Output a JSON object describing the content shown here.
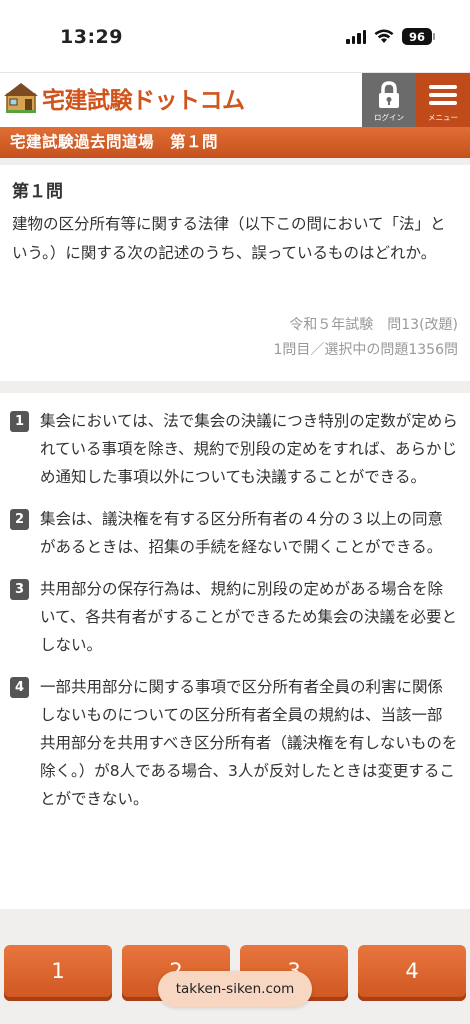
{
  "status": {
    "time": "13:29",
    "battery": "96",
    "icons": [
      "signal-icon",
      "wifi-icon",
      "battery-icon"
    ]
  },
  "header": {
    "logo_text": "宅建試験ドットコム",
    "login_label": "ログイン",
    "menu_label": "メニュー"
  },
  "subheader": {
    "title": "宅建試験過去問道場　第１問"
  },
  "question": {
    "title": "第１問",
    "text": "建物の区分所有等に関する法律（以下この問において「法」という。）に関する次の記述のうち、誤っているものはどれか。",
    "source": "令和５年試験　問13(改題)",
    "progress": "1問目／選択中の問題1356問"
  },
  "choices": [
    {
      "num": "1",
      "text": "集会においては、法で集会の決議につき特別の定数が定められている事項を除き、規約で別段の定めをすれば、あらかじめ通知した事項以外についても決議することができる。"
    },
    {
      "num": "2",
      "text": "集会は、議決権を有する区分所有者の４分の３以上の同意があるときは、招集の手続を経ないで開くことができる。"
    },
    {
      "num": "3",
      "text": "共用部分の保存行為は、規約に別段の定めがある場合を除いて、各共有者がすることができるため集会の決議を必要としない。"
    },
    {
      "num": "4",
      "text": "一部共用部分に関する事項で区分所有者全員の利害に関係しないものについての区分所有者全員の規約は、当該一部共用部分を共用すべき区分所有者（議決権を有しないものを除く。）が8人である場合、3人が反対したときは変更することができない。"
    }
  ],
  "answers": [
    "1",
    "2",
    "3",
    "4"
  ],
  "browser": {
    "url": "takken-siken.com"
  },
  "colors": {
    "accent": "#d0541c",
    "subheader": "#c6511d",
    "login_bg": "#6b6b6b",
    "menu_bg": "#c04a1a"
  }
}
